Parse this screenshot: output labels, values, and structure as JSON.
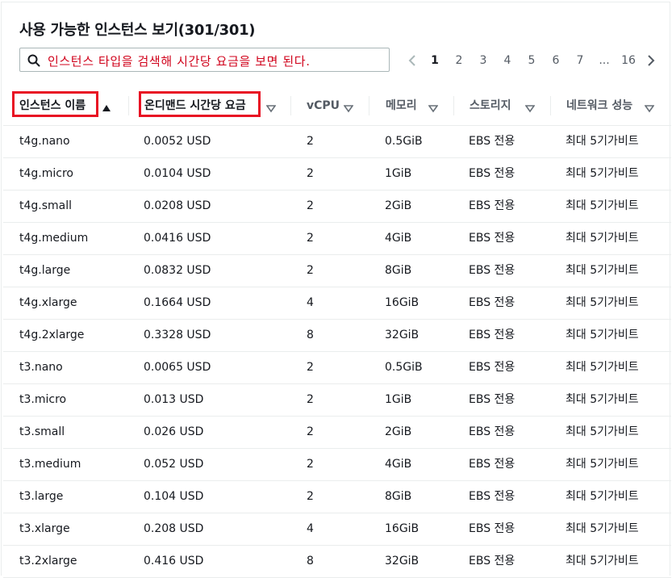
{
  "title": "사용 가능한 인스턴스 보기(301/301)",
  "search": {
    "value": "인스턴스 타입을 검색해 시간당 요금을 보면 된다."
  },
  "pagination": {
    "pages": [
      "1",
      "2",
      "3",
      "4",
      "5",
      "6",
      "7",
      "...",
      "16"
    ],
    "current": "1"
  },
  "columns": [
    {
      "label": "인스턴스 이름",
      "sort": "ascending"
    },
    {
      "label": "온디맨드 시간당 요금",
      "sort": "none"
    },
    {
      "label": "vCPU",
      "sort": "none"
    },
    {
      "label": "메모리",
      "sort": "none"
    },
    {
      "label": "스토리지",
      "sort": "none"
    },
    {
      "label": "네트워크 성능",
      "sort": "none"
    }
  ],
  "rows": [
    [
      "t4g.nano",
      "0.0052 USD",
      "2",
      "0.5GiB",
      "EBS 전용",
      "최대 5기가비트"
    ],
    [
      "t4g.micro",
      "0.0104 USD",
      "2",
      "1GiB",
      "EBS 전용",
      "최대 5기가비트"
    ],
    [
      "t4g.small",
      "0.0208 USD",
      "2",
      "2GiB",
      "EBS 전용",
      "최대 5기가비트"
    ],
    [
      "t4g.medium",
      "0.0416 USD",
      "2",
      "4GiB",
      "EBS 전용",
      "최대 5기가비트"
    ],
    [
      "t4g.large",
      "0.0832 USD",
      "2",
      "8GiB",
      "EBS 전용",
      "최대 5기가비트"
    ],
    [
      "t4g.xlarge",
      "0.1664 USD",
      "4",
      "16GiB",
      "EBS 전용",
      "최대 5기가비트"
    ],
    [
      "t4g.2xlarge",
      "0.3328 USD",
      "8",
      "32GiB",
      "EBS 전용",
      "최대 5기가비트"
    ],
    [
      "t3.nano",
      "0.0065 USD",
      "2",
      "0.5GiB",
      "EBS 전용",
      "최대 5기가비트"
    ],
    [
      "t3.micro",
      "0.013 USD",
      "2",
      "1GiB",
      "EBS 전용",
      "최대 5기가비트"
    ],
    [
      "t3.small",
      "0.026 USD",
      "2",
      "2GiB",
      "EBS 전용",
      "최대 5기가비트"
    ],
    [
      "t3.medium",
      "0.052 USD",
      "2",
      "4GiB",
      "EBS 전용",
      "최대 5기가비트"
    ],
    [
      "t3.large",
      "0.104 USD",
      "2",
      "8GiB",
      "EBS 전용",
      "최대 5기가비트"
    ],
    [
      "t3.xlarge",
      "0.208 USD",
      "4",
      "16GiB",
      "EBS 전용",
      "최대 5기가비트"
    ],
    [
      "t3.2xlarge",
      "0.416 USD",
      "8",
      "32GiB",
      "EBS 전용",
      "최대 5기가비트"
    ]
  ],
  "colors": {
    "highlight": "#e81123",
    "annotation_text": "#d0021b",
    "border": "#eaeded"
  },
  "icons": {
    "search": "search-icon",
    "prev": "chevron-left-icon",
    "next": "chevron-right-icon",
    "sort_asc": "sort-ascending-icon",
    "sort_none": "sort-caret-down-icon"
  }
}
